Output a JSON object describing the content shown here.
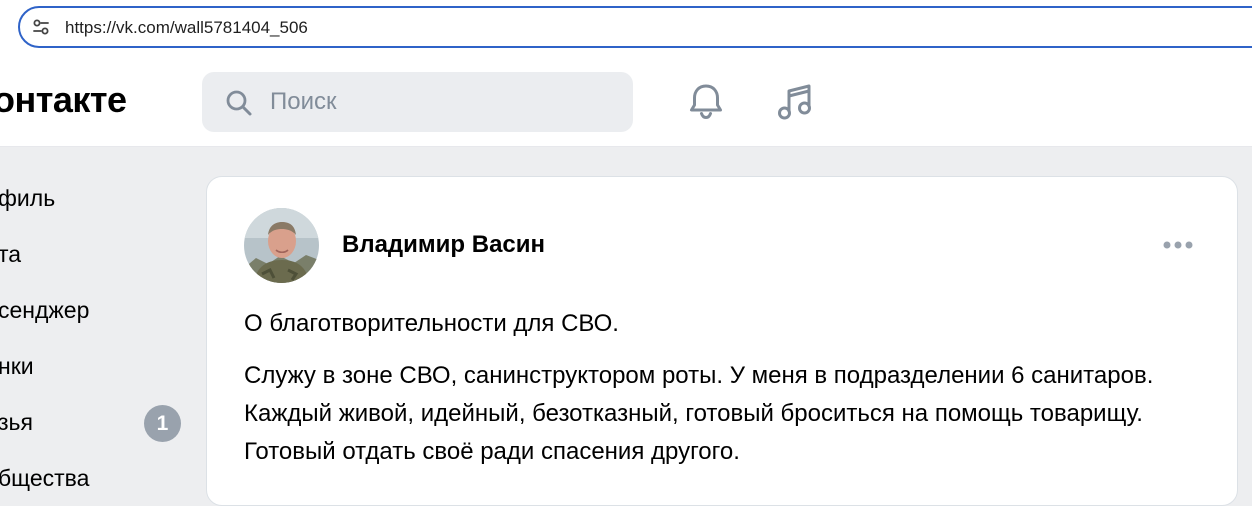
{
  "browser": {
    "url": "https://vk.com/wall5781404_506"
  },
  "header": {
    "logo_text": "онтакте",
    "search_placeholder": "Поиск",
    "icons": [
      "bell-icon",
      "music-icon"
    ]
  },
  "sidebar": {
    "items": [
      {
        "label": "филь"
      },
      {
        "label": "та"
      },
      {
        "label": "сенджер"
      },
      {
        "label": "нки"
      },
      {
        "label": "зья",
        "badge": "1"
      },
      {
        "label": "бщества"
      }
    ]
  },
  "post": {
    "author": "Владимир Васин",
    "paragraphs": [
      "О благотворительности для СВО.",
      "Служу в зоне СВО, санинструктором роты. У меня в подразделении 6 санитаров. Каждый живой, идейный, безотказный, готовый броситься на помощь товарищу. Готовый отдать своё ради спасения другого."
    ]
  },
  "colors": {
    "accent": "#2f63c8",
    "badge": "#99a2ad",
    "page_bg": "#edeef0",
    "muted": "#818c99"
  }
}
